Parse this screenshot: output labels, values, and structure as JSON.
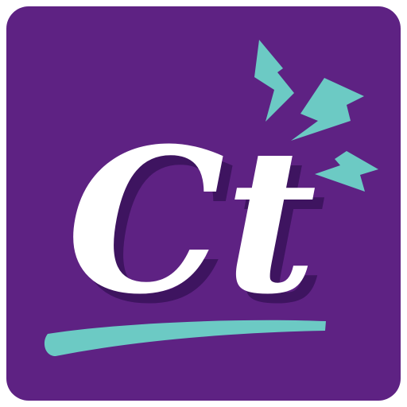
{
  "app_icon": {
    "monogram": "Ct",
    "colors": {
      "background": "#5e2283",
      "letters": "#ffffff",
      "shadow": "#3e1460",
      "accent": "#6ccac4"
    },
    "icons": [
      "lightning-bolt-icon",
      "underline-stroke"
    ]
  }
}
